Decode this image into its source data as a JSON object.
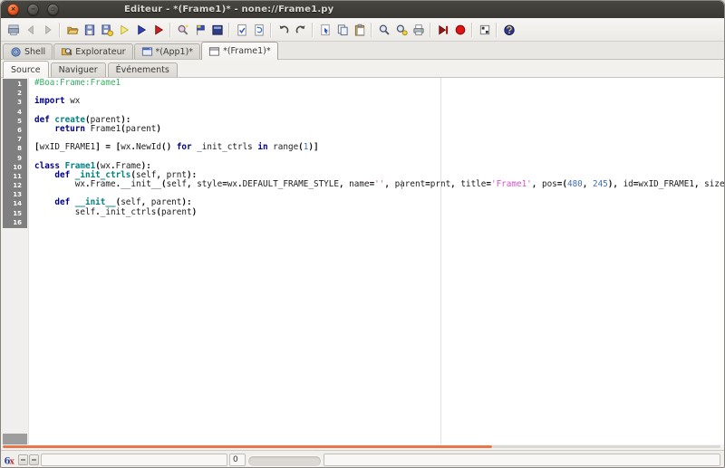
{
  "window": {
    "title": "Editeur - *(Frame1)* - none://Frame1.py",
    "controls": [
      "close-button",
      "minimize-button",
      "maximize-button"
    ]
  },
  "toolbar": {
    "icons": [
      "window-icon",
      "back-icon",
      "forward-icon",
      "open-file-icon",
      "save-icon",
      "save-as-icon",
      "run-app-icon",
      "run-module-icon",
      "debug-icon",
      "inspect-icon",
      "flag-icon",
      "panel-icon",
      "check-source-icon",
      "reload-icon",
      "undo-icon",
      "redo-icon",
      "cut-icon",
      "copy-icon",
      "paste-icon",
      "find-icon",
      "find-again-icon",
      "print-icon",
      "run-to-cursor-icon",
      "breakpoint-icon",
      "step-icon",
      "help-icon"
    ]
  },
  "tabs": {
    "items": [
      {
        "label": "Shell",
        "icon": "shell-icon",
        "active": false
      },
      {
        "label": "Explorateur",
        "icon": "explorer-icon",
        "active": false
      },
      {
        "label": "*(App1)*",
        "icon": "app-icon",
        "active": false
      },
      {
        "label": "*(Frame1)*",
        "icon": "frame-icon",
        "active": true
      }
    ]
  },
  "subtabs": {
    "items": [
      {
        "label": "Source",
        "active": true
      },
      {
        "label": "Naviguer",
        "active": false
      },
      {
        "label": "Événements",
        "active": false
      }
    ]
  },
  "editor": {
    "edge_column": 80,
    "lines": [
      {
        "n": 1,
        "s": [
          {
            "t": "#Boa:Frame:Frame1",
            "c": "c"
          }
        ]
      },
      {
        "n": 2,
        "s": []
      },
      {
        "n": 3,
        "s": [
          {
            "t": "import",
            "c": "k"
          },
          {
            "t": " wx",
            "c": "p"
          }
        ]
      },
      {
        "n": 4,
        "s": []
      },
      {
        "n": 5,
        "s": [
          {
            "t": "def",
            "c": "k"
          },
          {
            "t": " ",
            "c": "p"
          },
          {
            "t": "create",
            "c": "d"
          },
          {
            "t": "(",
            "c": "o"
          },
          {
            "t": "parent",
            "c": "p"
          },
          {
            "t": "):",
            "c": "o"
          }
        ]
      },
      {
        "n": 6,
        "s": [
          {
            "t": "    ",
            "c": "p"
          },
          {
            "t": "return",
            "c": "k"
          },
          {
            "t": " Frame1",
            "c": "p"
          },
          {
            "t": "(",
            "c": "o"
          },
          {
            "t": "parent",
            "c": "p"
          },
          {
            "t": ")",
            "c": "o"
          }
        ]
      },
      {
        "n": 7,
        "s": []
      },
      {
        "n": 8,
        "s": [
          {
            "t": "[",
            "c": "o"
          },
          {
            "t": "wxID_FRAME1",
            "c": "p"
          },
          {
            "t": "] ",
            "c": "o"
          },
          {
            "t": "=",
            "c": "o"
          },
          {
            "t": " [",
            "c": "o"
          },
          {
            "t": "wx",
            "c": "p"
          },
          {
            "t": ".",
            "c": "o"
          },
          {
            "t": "NewId",
            "c": "p"
          },
          {
            "t": "() ",
            "c": "o"
          },
          {
            "t": "for",
            "c": "k"
          },
          {
            "t": " _init_ctrls ",
            "c": "p"
          },
          {
            "t": "in",
            "c": "k"
          },
          {
            "t": " range",
            "c": "p"
          },
          {
            "t": "(",
            "c": "o"
          },
          {
            "t": "1",
            "c": "n"
          },
          {
            "t": ")]",
            "c": "o"
          }
        ]
      },
      {
        "n": 9,
        "s": []
      },
      {
        "n": 10,
        "s": [
          {
            "t": "class",
            "c": "k"
          },
          {
            "t": " ",
            "c": "p"
          },
          {
            "t": "Frame1",
            "c": "d"
          },
          {
            "t": "(",
            "c": "o"
          },
          {
            "t": "wx",
            "c": "p"
          },
          {
            "t": ".",
            "c": "o"
          },
          {
            "t": "Frame",
            "c": "p"
          },
          {
            "t": "):",
            "c": "o"
          }
        ]
      },
      {
        "n": 11,
        "s": [
          {
            "t": "    ",
            "c": "p"
          },
          {
            "t": "def",
            "c": "k"
          },
          {
            "t": " ",
            "c": "p"
          },
          {
            "t": "_init_ctrls",
            "c": "d"
          },
          {
            "t": "(",
            "c": "o"
          },
          {
            "t": "self",
            "c": "p"
          },
          {
            "t": ", ",
            "c": "o"
          },
          {
            "t": "prnt",
            "c": "p"
          },
          {
            "t": "):",
            "c": "o"
          }
        ]
      },
      {
        "n": 12,
        "s": [
          {
            "t": "        wx",
            "c": "p"
          },
          {
            "t": ".",
            "c": "o"
          },
          {
            "t": "Frame",
            "c": "p"
          },
          {
            "t": ".",
            "c": "o"
          },
          {
            "t": "__init__",
            "c": "p"
          },
          {
            "t": "(",
            "c": "o"
          },
          {
            "t": "self",
            "c": "p"
          },
          {
            "t": ", ",
            "c": "o"
          },
          {
            "t": "style",
            "c": "p"
          },
          {
            "t": "=",
            "c": "o"
          },
          {
            "t": "wx",
            "c": "p"
          },
          {
            "t": ".",
            "c": "o"
          },
          {
            "t": "DEFAULT_FRAME_STYLE",
            "c": "p"
          },
          {
            "t": ", ",
            "c": "o"
          },
          {
            "t": "name",
            "c": "p"
          },
          {
            "t": "=",
            "c": "o"
          },
          {
            "t": "''",
            "c": "s"
          },
          {
            "t": ", ",
            "c": "o"
          },
          {
            "t": "parent",
            "c": "p"
          },
          {
            "t": "=",
            "c": "o"
          },
          {
            "t": "prnt",
            "c": "p"
          },
          {
            "t": ", ",
            "c": "o"
          },
          {
            "t": "title",
            "c": "p"
          },
          {
            "t": "=",
            "c": "o"
          },
          {
            "t": "'Frame1'",
            "c": "s"
          },
          {
            "t": ", ",
            "c": "o"
          },
          {
            "t": "pos",
            "c": "p"
          },
          {
            "t": "=(",
            "c": "o"
          },
          {
            "t": "480",
            "c": "n"
          },
          {
            "t": ",",
            "c": "o"
          },
          {
            "t": " ",
            "c": "p"
          },
          {
            "t": "245",
            "c": "n"
          },
          {
            "t": "),",
            "c": "o"
          },
          {
            "t": " id",
            "c": "p"
          },
          {
            "t": "=",
            "c": "o"
          },
          {
            "t": "wxID_FRAME1",
            "c": "p"
          },
          {
            "t": ", ",
            "c": "o"
          },
          {
            "t": "size",
            "c": "p"
          }
        ]
      },
      {
        "n": 13,
        "s": []
      },
      {
        "n": 14,
        "s": [
          {
            "t": "    ",
            "c": "p"
          },
          {
            "t": "def",
            "c": "k"
          },
          {
            "t": " ",
            "c": "p"
          },
          {
            "t": "__init__",
            "c": "d"
          },
          {
            "t": "(",
            "c": "o"
          },
          {
            "t": "self",
            "c": "p"
          },
          {
            "t": ", ",
            "c": "o"
          },
          {
            "t": "parent",
            "c": "p"
          },
          {
            "t": "):",
            "c": "o"
          }
        ]
      },
      {
        "n": 15,
        "s": [
          {
            "t": "        self",
            "c": "p"
          },
          {
            "t": ".",
            "c": "o"
          },
          {
            "t": "_init_ctrls",
            "c": "p"
          },
          {
            "t": "(",
            "c": "o"
          },
          {
            "t": "parent",
            "c": "p"
          },
          {
            "t": ")",
            "c": "o"
          }
        ]
      },
      {
        "n": 16,
        "s": []
      }
    ]
  },
  "statusbar": {
    "message": "",
    "line_value": "0",
    "right_message": ""
  },
  "colors": {
    "scrollbar_thumb": "#e8764a",
    "keyword": "#00008b",
    "definition": "#008080",
    "comment": "#35ae64",
    "string": "#cf53c3",
    "number": "#3f6fb0",
    "gutter_bg": "#7f7f7f",
    "titlebar_bg": "#3c3b36"
  }
}
